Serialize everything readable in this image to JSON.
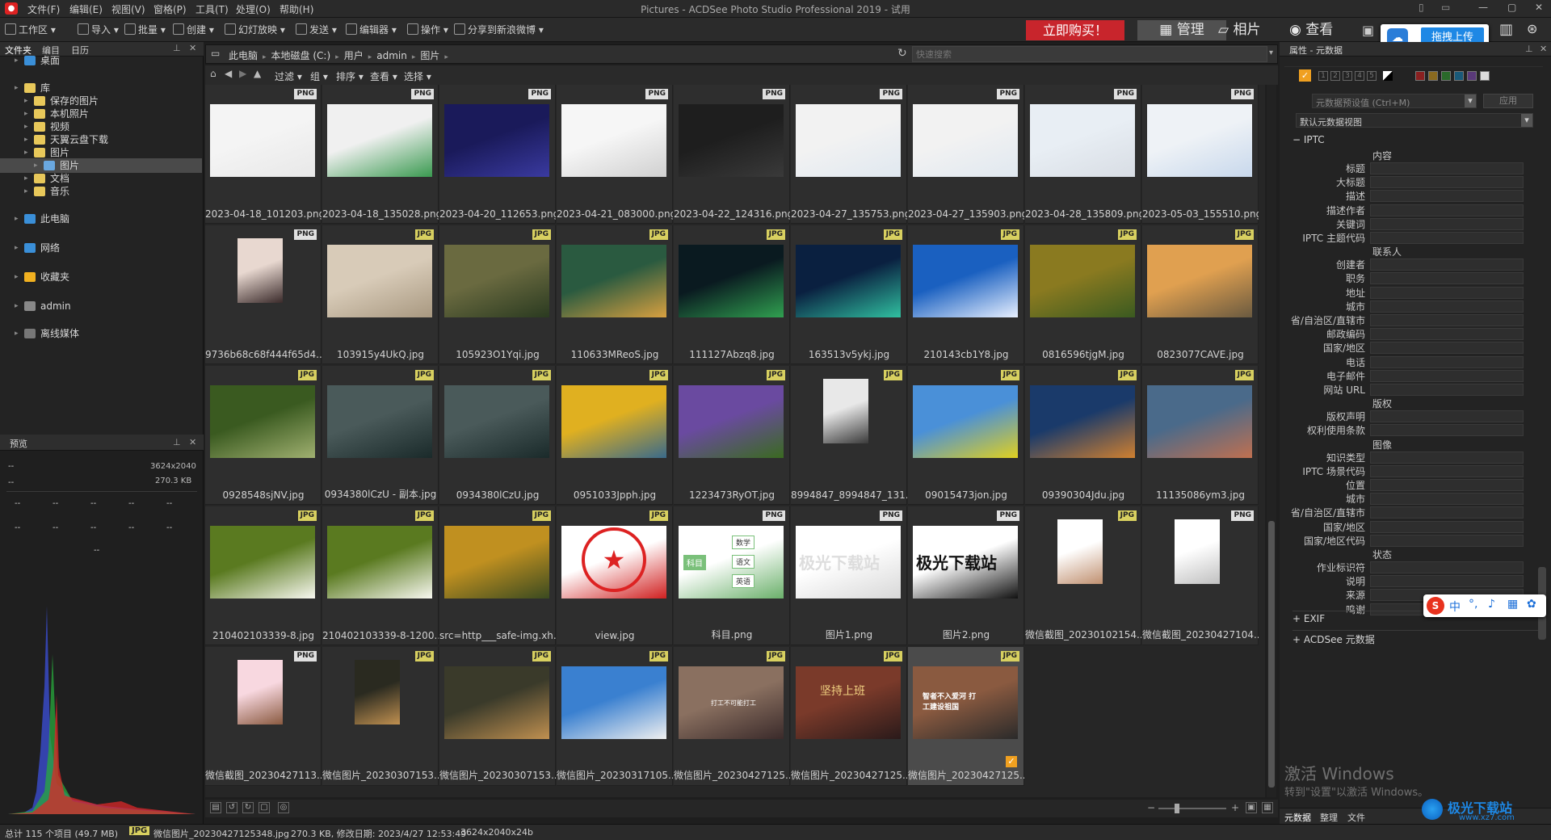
{
  "app": {
    "title": "Pictures - ACDSee Photo Studio Professional 2019 - 试用",
    "menu": [
      "文件(F)",
      "编辑(E)",
      "视图(V)",
      "窗格(P)",
      "工具(T)",
      "处理(O)",
      "帮助(H)"
    ]
  },
  "toolbar": {
    "items": [
      "工作区",
      "导入",
      "批量",
      "创建",
      "幻灯放映",
      "发送",
      "编辑器",
      "操作",
      "分享到新浪微博"
    ],
    "buy": "立即购买！",
    "modes": [
      "管理",
      "相片",
      "查看"
    ],
    "upload": "拖拽上传"
  },
  "left_panel": {
    "tabs": [
      "文件夹",
      "编目",
      "日历"
    ],
    "tree": [
      {
        "label": "桌面",
        "indent": 0,
        "icon": "#3a8fd8",
        "selected": false
      },
      {
        "label": "库",
        "indent": 0,
        "icon": "#e8c85a",
        "selected": false
      },
      {
        "label": "保存的图片",
        "indent": 1,
        "icon": "#e8c85a",
        "selected": false
      },
      {
        "label": "本机照片",
        "indent": 1,
        "icon": "#e8c85a",
        "selected": false
      },
      {
        "label": "视频",
        "indent": 1,
        "icon": "#e8c85a",
        "selected": false
      },
      {
        "label": "天翼云盘下载",
        "indent": 1,
        "icon": "#e8c85a",
        "selected": false
      },
      {
        "label": "图片",
        "indent": 1,
        "icon": "#e8c85a",
        "selected": false
      },
      {
        "label": "图片",
        "indent": 2,
        "icon": "#6aa8e0",
        "selected": true
      },
      {
        "label": "文档",
        "indent": 1,
        "icon": "#e8c85a",
        "selected": false
      },
      {
        "label": "音乐",
        "indent": 1,
        "icon": "#e8c85a",
        "selected": false
      },
      {
        "label": "此电脑",
        "indent": 0,
        "icon": "#3a8fd8",
        "selected": false
      },
      {
        "label": "网络",
        "indent": 0,
        "icon": "#3a8fd8",
        "selected": false
      },
      {
        "label": "收藏夹",
        "indent": 0,
        "icon": "#f0b020",
        "selected": false
      },
      {
        "label": "admin",
        "indent": 0,
        "icon": "#888888",
        "selected": false
      },
      {
        "label": "离线媒体",
        "indent": 0,
        "icon": "#777777",
        "selected": false
      }
    ]
  },
  "preview": {
    "title": "预览",
    "dims": "3624x2040",
    "size": "270.3 KB",
    "dash": "--"
  },
  "address": {
    "crumbs": [
      "此电脑",
      "本地磁盘 (C:)",
      "用户",
      "admin",
      "图片"
    ],
    "search_placeholder": "快速搜索"
  },
  "filter_bar": [
    "过滤",
    "组",
    "排序",
    "查看",
    "选择"
  ],
  "files": [
    {
      "name": "2023-04-18_101203.png",
      "type": "PNG",
      "c1": "#f4f4f4",
      "c2": "#e8e8e8"
    },
    {
      "name": "2023-04-18_135028.png",
      "type": "PNG",
      "c1": "#f0f0f0",
      "c2": "#3a9a50"
    },
    {
      "name": "2023-04-20_112653.png",
      "type": "PNG",
      "c1": "#1a1a5a",
      "c2": "#3a3aa0"
    },
    {
      "name": "2023-04-21_083000.png",
      "type": "PNG",
      "c1": "#f6f6f6",
      "c2": "#d0d0d0"
    },
    {
      "name": "2023-04-22_124316.png",
      "type": "PNG",
      "c1": "#1e1e1e",
      "c2": "#3a3a3a"
    },
    {
      "name": "2023-04-27_135753.png",
      "type": "PNG",
      "c1": "#f2f2f2",
      "c2": "#e0e8f0"
    },
    {
      "name": "2023-04-27_135903.png",
      "type": "PNG",
      "c1": "#f2f2f2",
      "c2": "#e0e8f0"
    },
    {
      "name": "2023-04-28_135809.png",
      "type": "PNG",
      "c1": "#e8eef4",
      "c2": "#d8dde4"
    },
    {
      "name": "2023-05-03_155510.png",
      "type": "PNG",
      "c1": "#eef2f6",
      "c2": "#c8d8ec"
    },
    {
      "name": "9736b68c68f444f65d4...",
      "type": "PNG",
      "c1": "#e8d8d0",
      "c2": "#3a2a2a"
    },
    {
      "name": "103915y4UkQ.jpg",
      "type": "JPG",
      "c1": "#d8cbb8",
      "c2": "#a89880"
    },
    {
      "name": "105923O1Yqi.jpg",
      "type": "JPG",
      "c1": "#6a6a40",
      "c2": "#2a3a20"
    },
    {
      "name": "110633MReoS.jpg",
      "type": "JPG",
      "c1": "#2a5a40",
      "c2": "#d8a040"
    },
    {
      "name": "111127Abzq8.jpg",
      "type": "JPG",
      "c1": "#0a1a20",
      "c2": "#30a050"
    },
    {
      "name": "163513v5ykj.jpg",
      "type": "JPG",
      "c1": "#0a2040",
      "c2": "#30c0a0"
    },
    {
      "name": "210143cb1Y8.jpg",
      "type": "JPG",
      "c1": "#1a60c0",
      "c2": "#e8f0ff"
    },
    {
      "name": "0816596tjgM.jpg",
      "type": "JPG",
      "c1": "#8a7a20",
      "c2": "#3a5a20"
    },
    {
      "name": "0823077CAVE.jpg",
      "type": "JPG",
      "c1": "#e0a050",
      "c2": "#6a5a40"
    },
    {
      "name": "0928548sjNV.jpg",
      "type": "JPG",
      "c1": "#3a5a20",
      "c2": "#a0b070"
    },
    {
      "name": "0934380lCzU - 副本.jpg",
      "type": "JPG",
      "c1": "#4a5a5a",
      "c2": "#1a2a2a"
    },
    {
      "name": "0934380lCzU.jpg",
      "type": "JPG",
      "c1": "#4a5a5a",
      "c2": "#1a2a2a"
    },
    {
      "name": "0951033Jpph.jpg",
      "type": "JPG",
      "c1": "#e0b020",
      "c2": "#3a6a8a"
    },
    {
      "name": "1223473RyOT.jpg",
      "type": "JPG",
      "c1": "#6a4aa0",
      "c2": "#3a6a20"
    },
    {
      "name": "8994847_8994847_131...",
      "type": "JPG",
      "c1": "#e8e8e8",
      "c2": "#3a3a3a"
    },
    {
      "name": "09015473jon.jpg",
      "type": "JPG",
      "c1": "#4a90d8",
      "c2": "#e0d020"
    },
    {
      "name": "09390304Jdu.jpg",
      "type": "JPG",
      "c1": "#1a3a6a",
      "c2": "#d08030"
    },
    {
      "name": "11135086ym3.jpg",
      "type": "JPG",
      "c1": "#4a6a8a",
      "c2": "#c07050"
    },
    {
      "name": "210402103339-8.jpg",
      "type": "JPG",
      "c1": "#5a7a20",
      "c2": "#f8f8f0"
    },
    {
      "name": "210402103339-8-1200...",
      "type": "JPG",
      "c1": "#5a7a20",
      "c2": "#f8f8f0"
    },
    {
      "name": "src=http___safe-img.xh...",
      "type": "JPG",
      "c1": "#c09020",
      "c2": "#3a4a20"
    },
    {
      "name": "view.jpg",
      "type": "JPG",
      "c1": "#ffffff",
      "c2": "#d02020"
    },
    {
      "name": "科目.png",
      "type": "PNG",
      "c1": "#ffffff",
      "c2": "#6ab06a"
    },
    {
      "name": "图片1.png",
      "type": "PNG",
      "c1": "#ffffff",
      "c2": "#d8d8d8"
    },
    {
      "name": "图片2.png",
      "type": "PNG",
      "c1": "#ffffff",
      "c2": "#111111"
    },
    {
      "name": "微信截图_20230102154...",
      "type": "JPG",
      "c1": "#ffffff",
      "c2": "#c09070"
    },
    {
      "name": "微信截图_20230427104...",
      "type": "PNG",
      "c1": "#ffffff",
      "c2": "#c0c0c0"
    },
    {
      "name": "微信截图_20230427113...",
      "type": "PNG",
      "c1": "#f8d8e0",
      "c2": "#8a5a40"
    },
    {
      "name": "微信图片_20230307153...",
      "type": "JPG",
      "c1": "#2a2a20",
      "c2": "#c09050"
    },
    {
      "name": "微信图片_20230307153...",
      "type": "JPG",
      "c1": "#3a3a2a",
      "c2": "#c09050"
    },
    {
      "name": "微信图片_20230317105...",
      "type": "JPG",
      "c1": "#3a80d0",
      "c2": "#f0f0f0"
    },
    {
      "name": "微信图片_20230427125...",
      "type": "JPG",
      "c1": "#8a7060",
      "c2": "#3a2a2a"
    },
    {
      "name": "微信图片_20230427125...",
      "type": "JPG",
      "c1": "#7a3a2a",
      "c2": "#2a1a1a"
    },
    {
      "name": "微信图片_20230427125...",
      "type": "JPG",
      "c1": "#8a5a40",
      "c2": "#2a2a2a"
    }
  ],
  "thumb_captions": {
    "mind_center": "科目",
    "mind_nodes": [
      "数学",
      "语文",
      "英语"
    ],
    "text1": "极光下载站",
    "text2": "极光下载站",
    "poster1": "打工不可能打工",
    "poster2": "坚持上班",
    "poster3": "智者不入爱河 打工建设祖国"
  },
  "right_panel": {
    "title": "属性 - 元数据",
    "preset": "元数据预设值 (Ctrl+M)",
    "apply": "应用",
    "view": "默认元数据视图",
    "section_iptc": "IPTC",
    "groups": [
      {
        "header": "内容",
        "fields": [
          "标题",
          "大标题",
          "描述",
          "描述作者",
          "关键词",
          "IPTC 主题代码"
        ]
      },
      {
        "header": "联系人",
        "fields": [
          "创建者",
          "职务",
          "地址",
          "城市",
          "省/自治区/直辖市",
          "邮政编码",
          "国家/地区",
          "电话",
          "电子邮件",
          "网站 URL"
        ]
      },
      {
        "header": "版权",
        "fields": [
          "版权声明",
          "权利使用条款"
        ]
      },
      {
        "header": "图像",
        "fields": [
          "知识类型",
          "IPTC 场景代码",
          "位置",
          "城市",
          "省/自治区/直辖市",
          "国家/地区",
          "国家/地区代码"
        ]
      },
      {
        "header": "状态",
        "fields": [
          "作业标识符",
          "说明",
          "来源",
          "鸣谢"
        ]
      }
    ],
    "section_exif": "EXIF",
    "section_acd": "ACDSee 元数据",
    "bottom_tabs": [
      "元数据",
      "整理",
      "文件"
    ],
    "rating": [
      "1",
      "2",
      "3",
      "4",
      "5"
    ]
  },
  "watermark": {
    "line1": "激活 Windows",
    "line2": "转到\"设置\"以激活 Windows。"
  },
  "site_logo": "极光下载站",
  "site_url": "www.xz7.com",
  "status": {
    "total": "总计 115 个项目 (49.7 MB)",
    "type": "JPG",
    "file": "微信图片_20230427125348.jpg",
    "info": "270.3 KB, 修改日期: 2023/4/27 12:53:49",
    "dims": "3624x2040x24b"
  },
  "ime": {
    "zh": "中"
  }
}
